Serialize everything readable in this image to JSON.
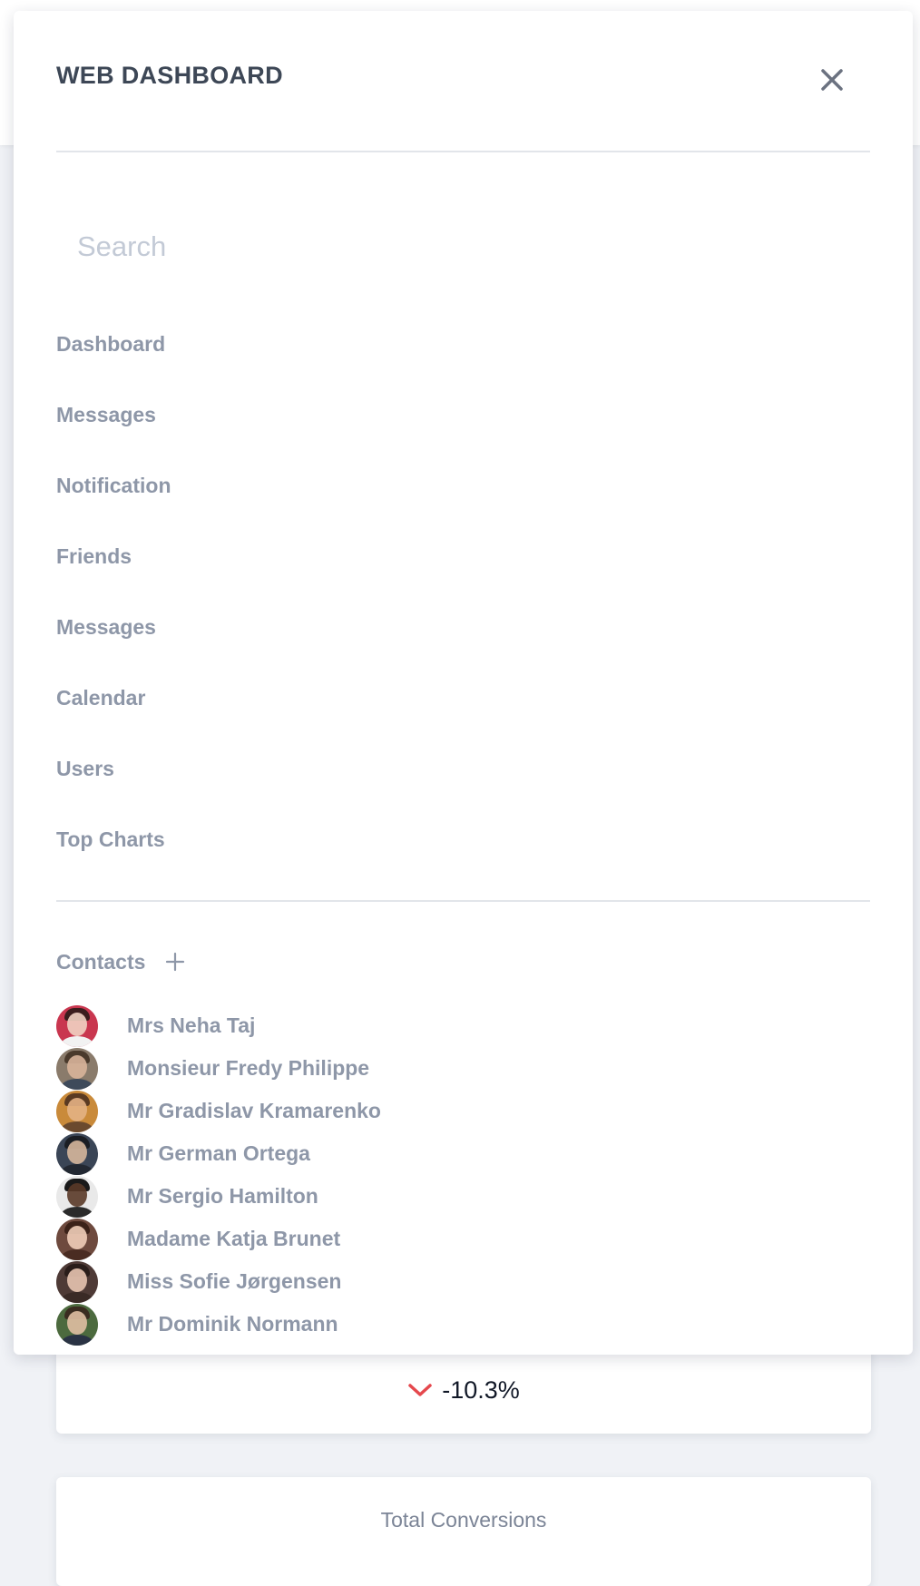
{
  "background": {
    "change_value": "-10.3%",
    "conversions_label": "Total Conversions",
    "colors": {
      "page_background": "#f0f2f6",
      "negative_change": "#e5484d"
    },
    "icons": {
      "change_direction": "chevron-down-icon"
    }
  },
  "drawer": {
    "title": "WEB DASHBOARD",
    "close_icon": "close-icon",
    "search": {
      "placeholder": "Search",
      "value": ""
    },
    "nav": [
      {
        "label": "Dashboard"
      },
      {
        "label": "Messages"
      },
      {
        "label": "Notification"
      },
      {
        "label": "Friends"
      },
      {
        "label": "Messages"
      },
      {
        "label": "Calendar"
      },
      {
        "label": "Users"
      },
      {
        "label": "Top Charts"
      }
    ],
    "contacts": {
      "title": "Contacts",
      "add_icon": "plus-icon",
      "items": [
        {
          "name": "Mrs Neha Taj"
        },
        {
          "name": "Monsieur Fredy Philippe"
        },
        {
          "name": "Mr Gradislav Kramarenko"
        },
        {
          "name": "Mr German Ortega"
        },
        {
          "name": "Mr Sergio Hamilton"
        },
        {
          "name": "Madame Katja Brunet"
        },
        {
          "name": "Miss Sofie Jørgensen"
        },
        {
          "name": "Mr Dominik Normann"
        }
      ]
    },
    "colors": {
      "title": "#3d4756",
      "nav_text": "#8e97a8",
      "divider": "#e2e5ea",
      "placeholder": "#c3cad6"
    }
  }
}
